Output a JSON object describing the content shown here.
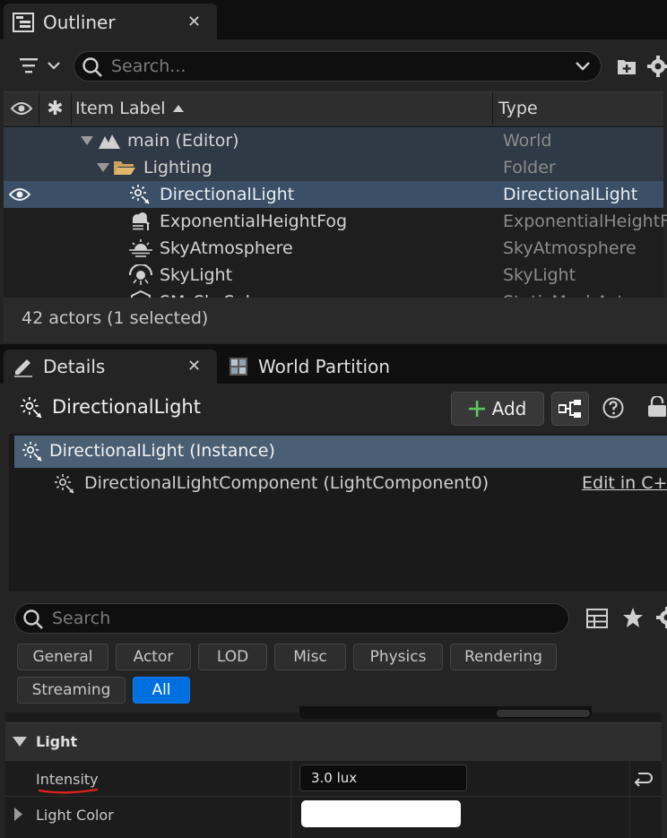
{
  "outliner": {
    "tab_title": "Outliner",
    "search_placeholder": "Search...",
    "columns": {
      "item_label": "Item Label",
      "type": "Type"
    },
    "rows": [
      {
        "label": "main (Editor)",
        "type": "World"
      },
      {
        "label": "Lighting",
        "type": "Folder"
      },
      {
        "label": "DirectionalLight",
        "type": "DirectionalLight"
      },
      {
        "label": "ExponentialHeightFog",
        "type": "ExponentialHeightFog"
      },
      {
        "label": "SkyAtmosphere",
        "type": "SkyAtmosphere"
      },
      {
        "label": "SkyLight",
        "type": "SkyLight"
      },
      {
        "label": "SM_SkySphere",
        "type": "StaticMeshActor"
      }
    ],
    "status": "42 actors (1 selected)"
  },
  "details": {
    "tab_title": "Details",
    "world_partition_tab": "World Partition",
    "actor_name": "DirectionalLight",
    "add_label": "Add",
    "components": {
      "instance": "DirectionalLight (Instance)",
      "child": "DirectionalLightComponent (LightComponent0)",
      "edit_link": "Edit in C++"
    },
    "search_placeholder": "Search",
    "filters": [
      "General",
      "Actor",
      "LOD",
      "Misc",
      "Physics",
      "Rendering",
      "Streaming",
      "All"
    ],
    "section_title": "Light",
    "properties": {
      "intensity_label": "Intensity",
      "intensity_value": "3.0 lux",
      "light_color_label": "Light Color"
    }
  },
  "colors": {
    "selected_row": "#3b4f66",
    "active_filter": "#0070e0",
    "annotation": "#e02020"
  }
}
